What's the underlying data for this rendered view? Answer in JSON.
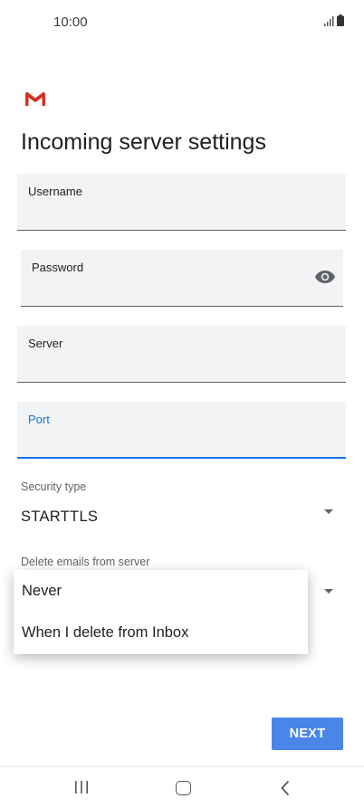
{
  "status_bar": {
    "time": "10:00"
  },
  "page": {
    "title": "Incoming server settings"
  },
  "fields": {
    "username": {
      "label": "Username",
      "value": ""
    },
    "password": {
      "label": "Password",
      "value": ""
    },
    "server": {
      "label": "Server",
      "value": ""
    },
    "port": {
      "label": "Port",
      "value": ""
    }
  },
  "security": {
    "label": "Security type",
    "value": "STARTTLS"
  },
  "delete_emails": {
    "label": "Delete emails from server",
    "options": [
      "Never",
      "When I delete from Inbox"
    ]
  },
  "actions": {
    "next_label": "NEXT"
  },
  "colors": {
    "accent": "#1a73e8",
    "button": "#4a86e8",
    "field_bg": "#f1f3f4",
    "gmail_red": "#d93025"
  }
}
